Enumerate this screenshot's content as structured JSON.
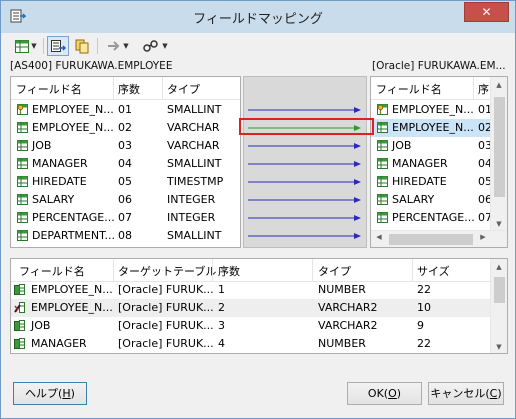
{
  "window": {
    "title": "フィールドマッピング",
    "close_glyph": "✕"
  },
  "toolbar": {
    "buttons": [
      {
        "name": "grid-view-icon"
      },
      {
        "name": "auto-map-icon"
      },
      {
        "name": "copy-mapping-icon"
      },
      {
        "name": "arrow-right-icon"
      },
      {
        "name": "tools-icon"
      }
    ]
  },
  "source": {
    "label": "[AS400] FURUKAWA.EMPLOYEE",
    "headers": [
      "フィールド名",
      "序数",
      "タイプ"
    ],
    "rows": [
      {
        "name": "EMPLOYEE_N...",
        "ord": "01",
        "type": "SMALLINT",
        "icon": "key-icon"
      },
      {
        "name": "EMPLOYEE_N...",
        "ord": "02",
        "type": "VARCHAR",
        "icon": "field-icon"
      },
      {
        "name": "JOB",
        "ord": "03",
        "type": "VARCHAR",
        "icon": "field-icon"
      },
      {
        "name": "MANAGER",
        "ord": "04",
        "type": "SMALLINT",
        "icon": "field-icon"
      },
      {
        "name": "HIREDATE",
        "ord": "05",
        "type": "TIMESTMP",
        "icon": "field-icon"
      },
      {
        "name": "SALARY",
        "ord": "06",
        "type": "INTEGER",
        "icon": "field-icon"
      },
      {
        "name": "PERCENTAGE...",
        "ord": "07",
        "type": "INTEGER",
        "icon": "field-icon"
      },
      {
        "name": "DEPARTMENT...",
        "ord": "08",
        "type": "SMALLINT",
        "icon": "field-icon"
      }
    ]
  },
  "target": {
    "label": "[Oracle] FURUKAWA.EM...",
    "headers": [
      "フィールド名",
      "序"
    ],
    "rows": [
      {
        "name": "EMPLOYEE_N...",
        "ord": "01",
        "icon": "key-icon"
      },
      {
        "name": "EMPLOYEE_N...",
        "ord": "02",
        "icon": "field-icon",
        "selected": true
      },
      {
        "name": "JOB",
        "ord": "03",
        "icon": "field-icon"
      },
      {
        "name": "MANAGER",
        "ord": "04",
        "icon": "field-icon"
      },
      {
        "name": "HIREDATE",
        "ord": "05",
        "icon": "field-icon"
      },
      {
        "name": "SALARY",
        "ord": "06",
        "icon": "field-icon"
      },
      {
        "name": "PERCENTAGE...",
        "ord": "07",
        "icon": "field-icon"
      }
    ]
  },
  "mapping": {
    "highlight_row": 2,
    "arrow_color": "#2b2bb8",
    "highlight_arrow_color": "#2e9a2e",
    "highlight_box_color": "#e02020"
  },
  "detail": {
    "headers": [
      "フィールド名",
      "ターゲットテーブル",
      "序数",
      "タイプ",
      "サイズ"
    ],
    "rows": [
      {
        "name": "EMPLOYEE_N...",
        "table": "[Oracle] FURUK...",
        "ord": "1",
        "type": "NUMBER",
        "size": "22",
        "icon": "mapped-field-icon"
      },
      {
        "name": "EMPLOYEE_N...",
        "table": "[Oracle] FURUK...",
        "ord": "2",
        "type": "VARCHAR2",
        "size": "10",
        "icon": "mapped-edit-icon",
        "selected": true
      },
      {
        "name": "JOB",
        "table": "[Oracle] FURUK...",
        "ord": "3",
        "type": "VARCHAR2",
        "size": "9",
        "icon": "mapped-field-icon"
      },
      {
        "name": "MANAGER",
        "table": "[Oracle] FURUK...",
        "ord": "4",
        "type": "NUMBER",
        "size": "22",
        "icon": "mapped-field-icon"
      }
    ]
  },
  "buttons": {
    "help": {
      "label": "ヘルプ(",
      "key": "H",
      "suffix": ")"
    },
    "ok": {
      "label": "OK(",
      "key": "O",
      "suffix": ")"
    },
    "cancel": {
      "label": "キャンセル(",
      "key": "C",
      "suffix": ")"
    }
  }
}
